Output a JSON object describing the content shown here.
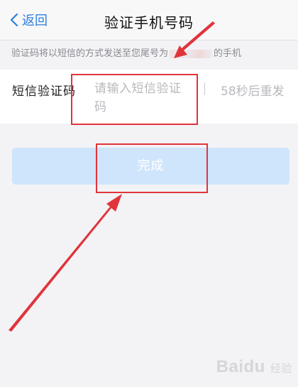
{
  "navbar": {
    "back_label": "返回",
    "title": "验证手机号码",
    "back_icon": "chevron-left-icon"
  },
  "hint": {
    "prefix": "验证码将以短信的方式发送至您尾号为",
    "suffix": "的手机"
  },
  "verification": {
    "label": "短信验证码",
    "placeholder": "请输入短信验证码",
    "resend_text": "58秒后重发"
  },
  "done_button": {
    "label": "完成"
  },
  "colors": {
    "accent": "#2f7ee0",
    "button_disabled_bg": "#cfe5fb",
    "annotation_red": "#e0343b"
  },
  "watermark": {
    "brand": "Baidu",
    "sub": "经验"
  }
}
